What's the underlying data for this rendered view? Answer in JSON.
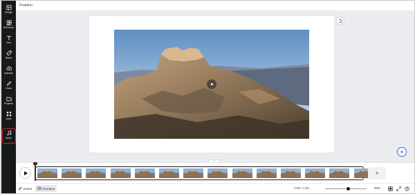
{
  "header": {
    "title": "Position"
  },
  "sidebar": {
    "items": [
      {
        "label": "Design",
        "icon": "design-icon"
      },
      {
        "label": "Elements",
        "icon": "elements-icon"
      },
      {
        "label": "Text",
        "icon": "text-icon"
      },
      {
        "label": "Brand",
        "icon": "brand-icon"
      },
      {
        "label": "Uploads",
        "icon": "uploads-icon"
      },
      {
        "label": "Draw",
        "icon": "draw-icon"
      },
      {
        "label": "Projects",
        "icon": "projects-icon"
      },
      {
        "label": "Apps",
        "icon": "apps-icon"
      },
      {
        "label": "Audio",
        "icon": "audio-icon",
        "highlighted": true
      }
    ]
  },
  "timeline": {
    "clip_count": 14,
    "add_label": "+"
  },
  "status": {
    "notes_label": "Notes",
    "duration_label": "Duration",
    "time": "0:00 / 1:03",
    "zoom": "56%",
    "zoom_level": 0.56
  },
  "colors": {
    "sidebar_bg": "#18191b",
    "highlight": "#d8232a",
    "accent": "#2a6fdb",
    "workspace_bg": "#ebecf0"
  }
}
